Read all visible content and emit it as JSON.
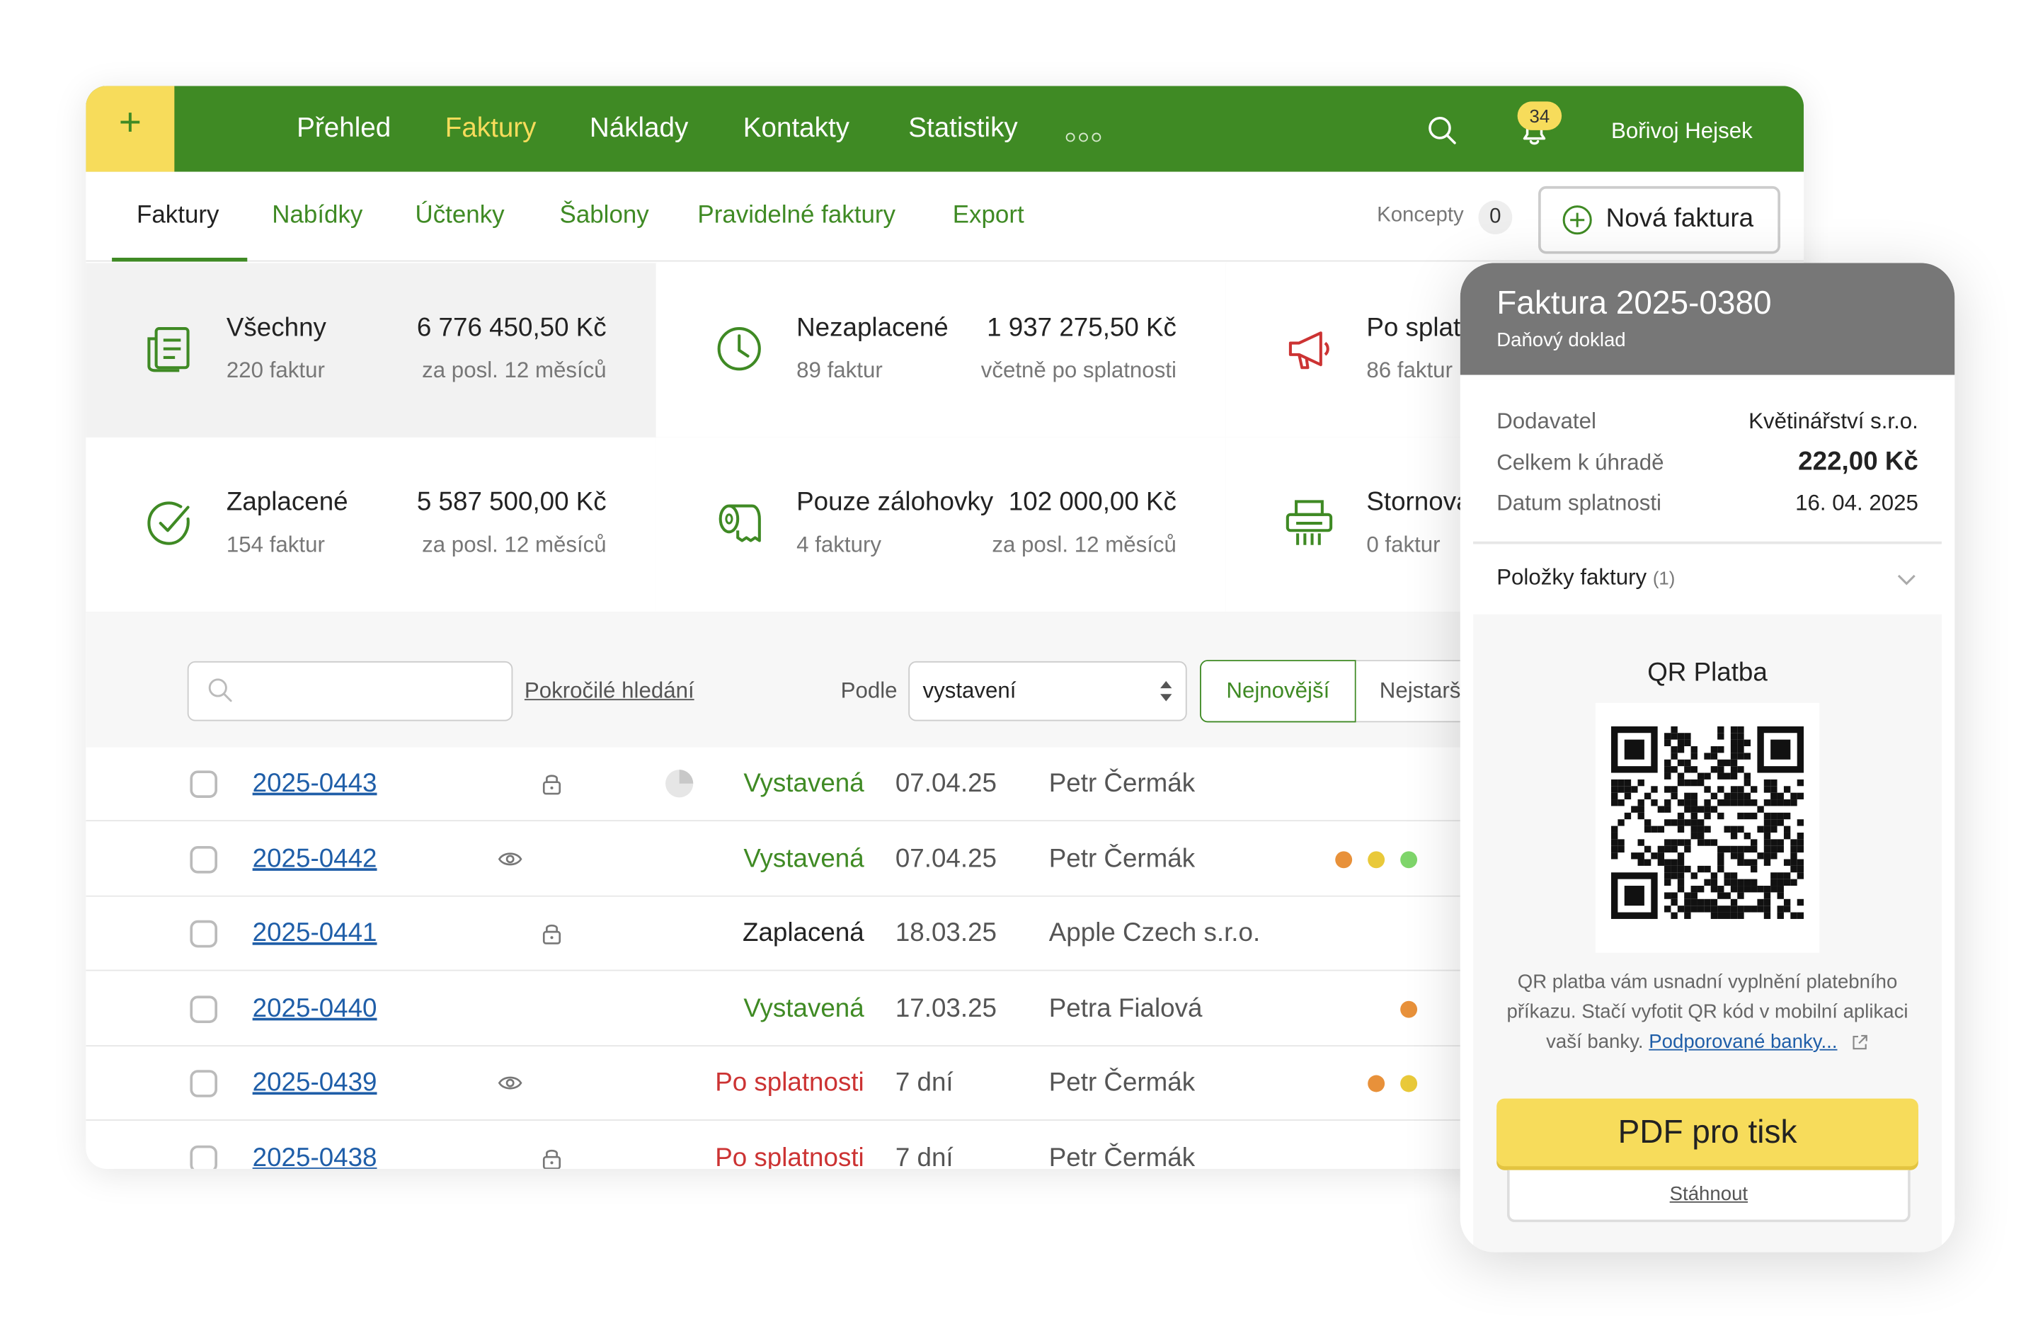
{
  "nav": {
    "items": [
      {
        "label": "Přehled"
      },
      {
        "label": "Faktury"
      },
      {
        "label": "Náklady"
      },
      {
        "label": "Kontakty"
      },
      {
        "label": "Statistiky"
      }
    ],
    "active": "Faktury",
    "plus_label": "+",
    "notifications_count": "34",
    "user_name": "Bořivoj Hejsek"
  },
  "subnav": {
    "items": [
      {
        "label": "Faktury"
      },
      {
        "label": "Nabídky"
      },
      {
        "label": "Účtenky"
      },
      {
        "label": "Šablony"
      },
      {
        "label": "Pravidelné faktury"
      },
      {
        "label": "Export"
      }
    ],
    "active": "Faktury",
    "drafts_label": "Koncepty",
    "drafts_count": "0",
    "new_invoice_label": "Nová faktura"
  },
  "stats": [
    {
      "name": "Všechny",
      "count": "220 faktur",
      "amount": "6 776 450,50 Kč",
      "period": "za posl. 12 měsíců",
      "icon": "document-icon",
      "selected": true
    },
    {
      "name": "Nezaplacené",
      "count": "89 faktur",
      "amount": "1 937 275,50 Kč",
      "period": "včetně po splatnosti",
      "icon": "clock-icon"
    },
    {
      "name": "Po splat",
      "count": "86 faktur",
      "amount": "",
      "period": "",
      "icon": "megaphone-icon"
    },
    {
      "name": "Zaplacené",
      "count": "154 faktur",
      "amount": "5 587 500,00 Kč",
      "period": "za posl. 12 měsíců",
      "icon": "check-circle-icon"
    },
    {
      "name": "Pouze zálohovky",
      "count": "4 faktury",
      "amount": "102 000,00 Kč",
      "period": "za posl. 12 měsíců",
      "icon": "receipt-roll-icon"
    },
    {
      "name": "Stornova",
      "count": "0 faktur",
      "amount": "",
      "period": "",
      "icon": "shredder-icon"
    }
  ],
  "filters": {
    "search_value": "",
    "advanced_search_label": "Pokročilé hledání",
    "sort_by_label": "Podle",
    "sort_by_value": "vystavení",
    "sort_newest_label": "Nejnovější",
    "sort_oldest_label": "Nejstarš"
  },
  "invoices": [
    {
      "number": "2025-0443",
      "icon": "lock-icon",
      "status": "Vystavená",
      "status_color": "#3f8a24",
      "date": "07.04.25",
      "client": "Petr Čermák",
      "tags": [],
      "pie": true
    },
    {
      "number": "2025-0442",
      "icon": "eye-icon",
      "status": "Vystavená",
      "status_color": "#3f8a24",
      "date": "07.04.25",
      "client": "Petr Čermák",
      "tags": [
        "#e8913a",
        "#e9c93a",
        "#7fd56b"
      ]
    },
    {
      "number": "2025-0441",
      "icon": "lock-icon",
      "status": "Zaplacená",
      "status_color": "#222222",
      "date": "18.03.25",
      "client": "Apple Czech s.r.o.",
      "tags": []
    },
    {
      "number": "2025-0440",
      "icon": "",
      "status": "Vystavená",
      "status_color": "#3f8a24",
      "date": "17.03.25",
      "client": "Petra Fialová",
      "tags": [
        "#e8913a"
      ]
    },
    {
      "number": "2025-0439",
      "icon": "eye-icon",
      "status": "Po splatnosti",
      "status_color": "#cc3333",
      "date": "7 dní",
      "client": "Petr Čermák",
      "tags": [
        "#e8913a",
        "#e9c93a"
      ]
    },
    {
      "number": "2025-0438",
      "icon": "lock-icon",
      "status": "Po splatnosti",
      "status_color": "#cc3333",
      "date": "7 dní",
      "client": "Petr Čermák",
      "tags": []
    }
  ],
  "panel": {
    "title": "Faktura 2025-0380",
    "subtitle": "Daňový doklad",
    "supplier_label": "Dodavatel",
    "supplier_value": "Květinářství s.r.o.",
    "total_label": "Celkem k úhradě",
    "total_value": "222,00 Kč",
    "due_label": "Datum splatnosti",
    "due_value": "16. 04. 2025",
    "items_label": "Položky faktury",
    "items_count": "(1)",
    "qr_title": "QR Platba",
    "qr_text": "QR platba vám usnadní vyplnění platebního příkazu. Stačí vyfotit QR kód v mobilní aplikaci vaší banky.",
    "qr_link": "Podporované banky...",
    "pdf_label": "PDF pro tisk",
    "download_label": "Stáhnout"
  },
  "colors": {
    "brand_green": "#3f8a24",
    "accent_yellow": "#f7dc5b",
    "link_blue": "#1f5ea8",
    "overdue_red": "#cc3333"
  }
}
